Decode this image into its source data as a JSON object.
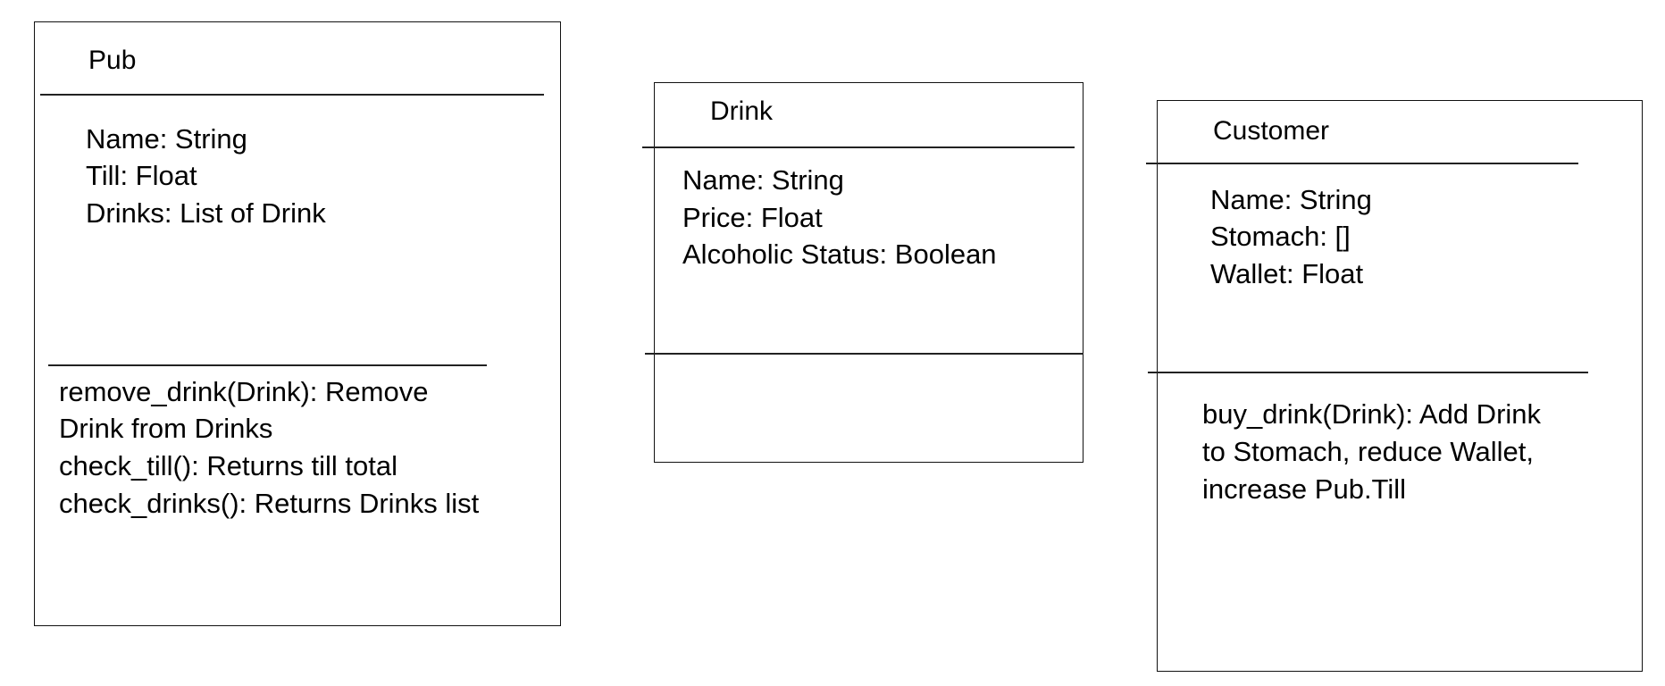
{
  "classes": [
    {
      "name": "Pub",
      "attributes": [
        "Name: String",
        "Till: Float",
        "Drinks: List of Drink"
      ],
      "methods": [
        "remove_drink(Drink): Remove",
        "Drink from Drinks",
        "check_till(): Returns till total",
        "check_drinks(): Returns Drinks list"
      ]
    },
    {
      "name": "Drink",
      "attributes": [
        "Name: String",
        "Price: Float",
        "Alcoholic Status: Boolean"
      ],
      "methods": []
    },
    {
      "name": "Customer",
      "attributes": [
        "Name: String",
        "Stomach: []",
        "Wallet: Float"
      ],
      "methods": [
        "buy_drink(Drink): Add Drink",
        "to Stomach, reduce Wallet,",
        "increase Pub.Till"
      ]
    }
  ]
}
